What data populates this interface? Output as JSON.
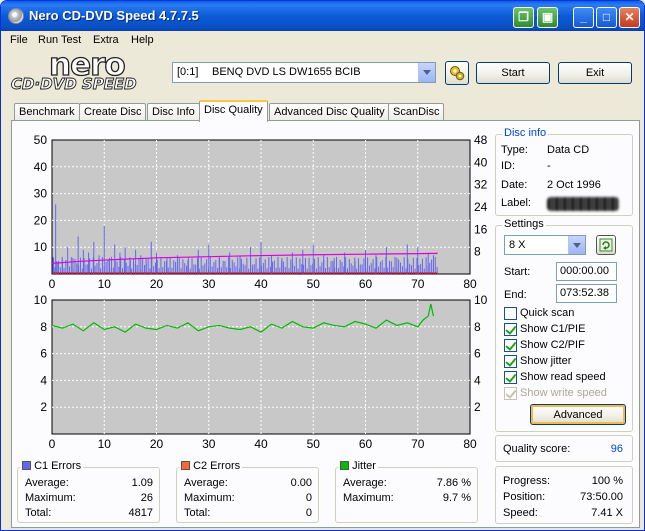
{
  "window": {
    "title": "Nero CD-DVD Speed 4.7.7.5"
  },
  "menu": [
    "File",
    "Run Test",
    "Extra",
    "Help"
  ],
  "logo": {
    "line1": "nero",
    "line2": "CD·DVD SPEED"
  },
  "toolbar": {
    "drive_id": "[0:1]",
    "drive_name": "BENQ DVD LS DW1655 BCIB",
    "start_label": "Start",
    "exit_label": "Exit"
  },
  "tabs": [
    {
      "label": "Benchmark"
    },
    {
      "label": "Create Disc"
    },
    {
      "label": "Disc Info"
    },
    {
      "label": "Disc Quality",
      "active": true
    },
    {
      "label": "Advanced Disc Quality"
    },
    {
      "label": "ScanDisc"
    }
  ],
  "disc_info": {
    "title": "Disc info",
    "type_label": "Type:",
    "type_value": "Data CD",
    "id_label": "ID:",
    "id_value": "-",
    "date_label": "Date:",
    "date_value": "2 Oct 1996",
    "label_label": "Label:"
  },
  "settings": {
    "title": "Settings",
    "speed": "8 X",
    "start_label": "Start:",
    "start_value": "000:00.00",
    "end_label": "End:",
    "end_value": "073:52.38",
    "options": [
      {
        "label": "Quick scan",
        "checked": false,
        "enabled": true
      },
      {
        "label": "Show C1/PIE",
        "checked": true,
        "enabled": true
      },
      {
        "label": "Show C2/PIF",
        "checked": true,
        "enabled": true
      },
      {
        "label": "Show jitter",
        "checked": true,
        "enabled": true
      },
      {
        "label": "Show read speed",
        "checked": true,
        "enabled": true
      },
      {
        "label": "Show write speed",
        "checked": true,
        "enabled": false
      }
    ],
    "advanced_label": "Advanced"
  },
  "quality": {
    "label": "Quality score:",
    "value": "96"
  },
  "progress": {
    "progress_label": "Progress:",
    "progress_value": "100 %",
    "position_label": "Position:",
    "position_value": "73:50.00",
    "speed_label": "Speed:",
    "speed_value": "7.41 X"
  },
  "stats": {
    "c1": {
      "title": "C1 Errors",
      "avg_label": "Average:",
      "avg": "1.09",
      "max_label": "Maximum:",
      "max": "26",
      "total_label": "Total:",
      "total": "4817"
    },
    "c2": {
      "title": "C2 Errors",
      "avg_label": "Average:",
      "avg": "0.00",
      "max_label": "Maximum:",
      "max": "0",
      "total_label": "Total:",
      "total": "0"
    },
    "jitter": {
      "title": "Jitter",
      "avg_label": "Average:",
      "avg": "7.86 %",
      "max_label": "Maximum:",
      "max": "9.7 %"
    }
  },
  "colors": {
    "c1_series": "#6666ee",
    "c2_series": "#ff6633",
    "jitter_series": "#00bb00",
    "read_speed": "#dd00dd",
    "plot_bg": "#c8c8c8",
    "accent": "#0046d5"
  },
  "chart_data": [
    {
      "type": "bar",
      "name": "errors",
      "xlim": [
        0,
        80
      ],
      "ylim_left": [
        0,
        50
      ],
      "ylim_right": [
        0,
        48
      ],
      "x_ticks": [
        0,
        10,
        20,
        30,
        40,
        50,
        60,
        70,
        80
      ],
      "y_ticks_left": [
        10,
        20,
        30,
        40,
        50
      ],
      "y_ticks_right": [
        8,
        16,
        24,
        32,
        40,
        48
      ],
      "grid": true,
      "series": [
        {
          "name": "C1 Errors",
          "x": [
            0.3,
            0.7,
            1,
            2,
            3,
            4,
            5,
            6,
            7,
            8,
            9,
            10,
            11,
            12,
            13,
            14,
            15,
            16,
            17,
            18,
            19,
            20,
            22,
            24,
            26,
            28,
            30,
            32,
            34,
            36,
            38,
            40,
            42,
            44,
            46,
            48,
            50,
            52,
            54,
            56,
            58,
            60,
            62,
            64,
            66,
            68,
            70,
            72,
            73
          ],
          "values": [
            6,
            26,
            4,
            5,
            10,
            6,
            14,
            9,
            8,
            12,
            7,
            18,
            6,
            11,
            8,
            10,
            5,
            9,
            7,
            6,
            12,
            8,
            6,
            7,
            5,
            9,
            11,
            6,
            8,
            7,
            10,
            12,
            7,
            6,
            8,
            9,
            11,
            7,
            6,
            8,
            5,
            9,
            7,
            10,
            6,
            11,
            10,
            8,
            7
          ]
        },
        {
          "name": "Read Speed",
          "axis": "right",
          "x": [
            0,
            5,
            10,
            20,
            30,
            40,
            50,
            60,
            70,
            73.8
          ],
          "values": [
            3.8,
            4.5,
            5.0,
            5.8,
            6.2,
            6.6,
            6.9,
            7.1,
            7.3,
            7.4
          ]
        }
      ]
    },
    {
      "type": "line",
      "name": "jitter",
      "xlim": [
        0,
        80
      ],
      "ylim": [
        0,
        10
      ],
      "x_ticks": [
        0,
        10,
        20,
        30,
        40,
        50,
        60,
        70,
        80
      ],
      "y_ticks": [
        2,
        4,
        6,
        8,
        10
      ],
      "grid": true,
      "series": [
        {
          "name": "Jitter",
          "x": [
            0,
            2,
            4,
            6,
            8,
            10,
            12,
            14,
            16,
            18,
            20,
            22,
            24,
            26,
            28,
            30,
            32,
            34,
            36,
            38,
            40,
            42,
            44,
            46,
            48,
            50,
            52,
            54,
            56,
            58,
            60,
            62,
            64,
            66,
            68,
            70,
            71,
            72,
            72.5,
            73
          ],
          "values": [
            8.1,
            7.9,
            8.2,
            7.7,
            8.3,
            7.8,
            8.0,
            7.6,
            8.2,
            7.9,
            7.8,
            8.1,
            7.9,
            8.3,
            7.7,
            8.0,
            8.1,
            7.9,
            7.8,
            8.0,
            7.6,
            8.2,
            7.9,
            8.4,
            8.0,
            7.9,
            8.3,
            8.1,
            8.0,
            8.4,
            8.2,
            7.9,
            8.5,
            8.1,
            8.3,
            8.0,
            8.5,
            8.8,
            9.7,
            8.8
          ]
        }
      ]
    }
  ]
}
